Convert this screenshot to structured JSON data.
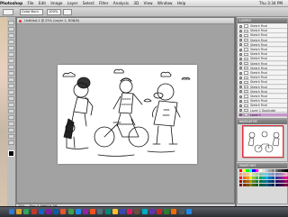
{
  "menubar": {
    "items": [
      "Photoshop",
      "File",
      "Edit",
      "Image",
      "Layer",
      "Select",
      "Filter",
      "Analysis",
      "3D",
      "View",
      "Window",
      "Help"
    ],
    "clock": "Thu 3:34 PM"
  },
  "options": {
    "mode_value": "Color Burn",
    "opacity_value": "100%"
  },
  "document": {
    "tab_title": "Untitled-1 @ 25% (Layer 1, RGB/8)",
    "zoom_status": "25%",
    "status_text": "Doc: 4.59M/24.2M"
  },
  "layers": {
    "title": "LAYERS",
    "rows": [
      "Sketch Final",
      "Sketch Final",
      "Sketch Final",
      "Sketch Final",
      "Sketch Final",
      "Sketch Final",
      "Sketch Final",
      "Sketch Final",
      "Sketch Final",
      "Sketch Final",
      "Sketch Final",
      "Sketch Final",
      "Sketch Final",
      "Sketch Final",
      "Sketch Final",
      "Sketch Final",
      "Sketch Final",
      "Sketch Final",
      "Layer 1 Duplicate",
      "Layer 1"
    ],
    "selected_index": 19
  },
  "navigator": {
    "title": "NAVIGATOR"
  },
  "swatches": {
    "title": "SWATCHES",
    "colors": [
      "#ff0000",
      "#ffff00",
      "#00ff00",
      "#00ffff",
      "#0000ff",
      "#ff00ff",
      "#ffffff",
      "#e0e0e0",
      "#c0c0c0",
      "#a0a0a0",
      "#808080",
      "#606060",
      "#404040",
      "#202020",
      "#000000",
      "#f7977a",
      "#f9ad81",
      "#fdc68a",
      "#fff79a",
      "#c4df9b",
      "#a2d39c",
      "#82ca9d",
      "#7bcdc8",
      "#6ecff6",
      "#7ea7d8",
      "#8493ca",
      "#8882be",
      "#a187be",
      "#bc8dbf",
      "#f49ac2",
      "#ed1c24",
      "#f26522",
      "#f7941d",
      "#fff200",
      "#8dc73f",
      "#39b54a",
      "#00a651",
      "#00a99d",
      "#00aeef",
      "#0072bc",
      "#0054a6",
      "#2e3192",
      "#662d91",
      "#92278f",
      "#ec008c",
      "#9e0b0f",
      "#a0410d",
      "#a36209",
      "#aba000",
      "#598527",
      "#1a7b30",
      "#007236",
      "#00746b",
      "#0076a3",
      "#004b80",
      "#003471",
      "#1b1464",
      "#440e62",
      "#630460",
      "#9e005d",
      "#790000",
      "#7b2e00",
      "#7d4900",
      "#827b00",
      "#406618",
      "#005e20",
      "#005826",
      "#005952",
      "#005b7f",
      "#003663",
      "#002157",
      "#0d004c",
      "#32004b",
      "#4b0049",
      "#7b0046"
    ]
  },
  "taskbar": {
    "colors": [
      "#2d7bd6",
      "#d9a02b",
      "#31a35b",
      "#c0392b",
      "#1565c0",
      "#7b1fa2",
      "#0d5aa7",
      "#e4572e",
      "#43a047",
      "#1e88e5",
      "#8e24aa",
      "#f4511e",
      "#546e7a",
      "#00897b",
      "#fbc02d",
      "#3949ab",
      "#d81b60",
      "#6d4c41",
      "#00acc1",
      "#5e35b1",
      "#c62828",
      "#2e7d32",
      "#ef6c00",
      "#455a64",
      "#1e88e5"
    ]
  }
}
